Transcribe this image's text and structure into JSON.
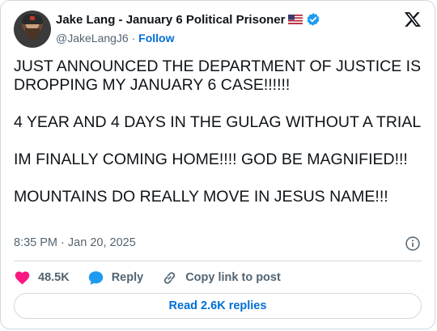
{
  "author": {
    "name": "Jake Lang - January 6 Political Prisoner",
    "handle": "@JakeLangJ6",
    "separator": "·",
    "follow_label": "Follow"
  },
  "icons": {
    "flag": "us-flag-icon",
    "verified": "verified-badge-icon",
    "platform": "x-logo-icon",
    "info": "info-icon",
    "like": "heart-icon",
    "reply": "speech-bubble-icon",
    "copy": "link-icon"
  },
  "colors": {
    "accent": "#1d9bf0",
    "link": "#006fd6",
    "like": "#f91880",
    "text": "#0f1419",
    "muted": "#536471",
    "border": "#cfd9de"
  },
  "tweet": {
    "paragraphs": [
      "JUST ANNOUNCED THE DEPARTMENT OF JUSTICE IS DROPPING MY JANUARY 6 CASE!!!!!!",
      "4 YEAR AND 4 DAYS IN THE GULAG WITHOUT A TRIAL",
      "IM FINALLY COMING HOME!!!! GOD BE MAGNIFIED!!!",
      "MOUNTAINS DO REALLY MOVE IN JESUS NAME!!!"
    ],
    "time": "8:35 PM",
    "date_separator": "·",
    "date": "Jan 20, 2025"
  },
  "actions": {
    "likes": "48.5K",
    "reply_label": "Reply",
    "copy_label": "Copy link to post"
  },
  "read_replies_label": "Read 2.6K replies"
}
